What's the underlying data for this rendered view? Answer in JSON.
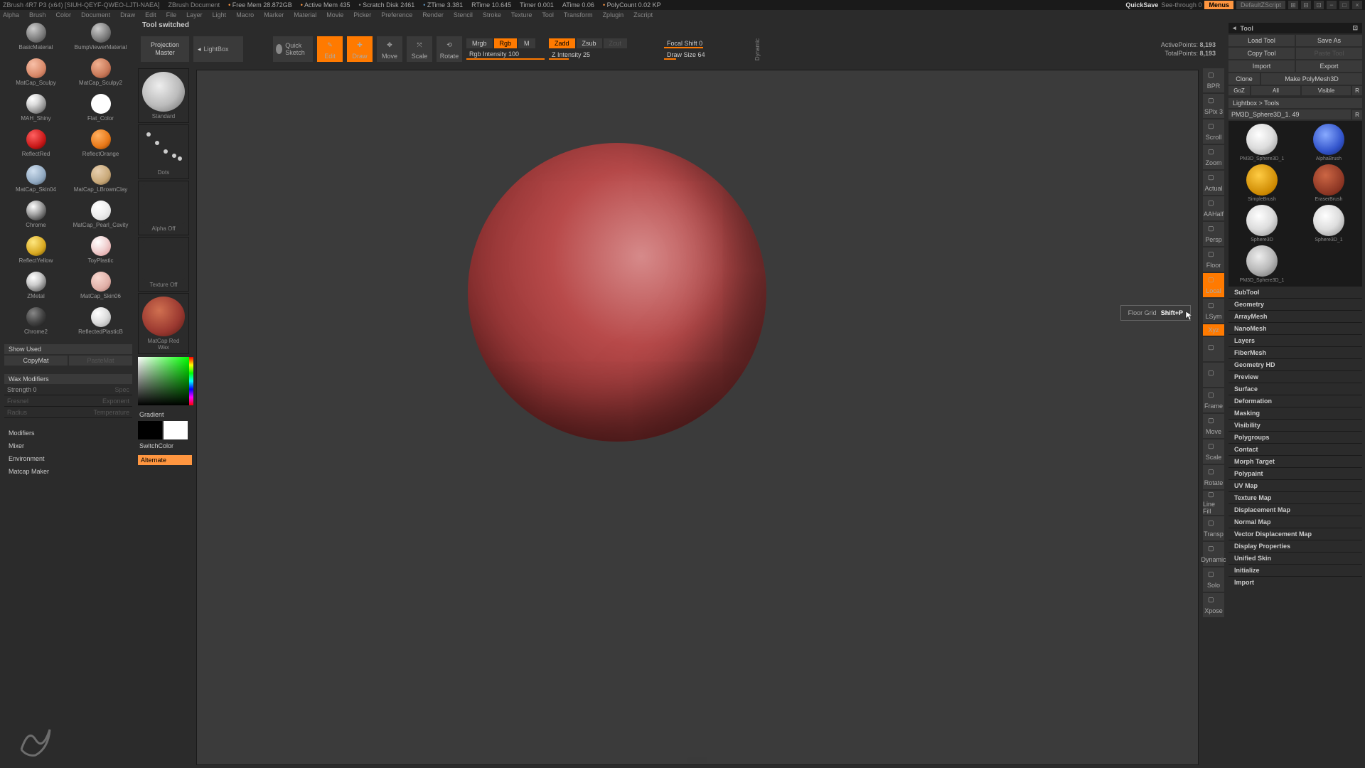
{
  "titlebar": {
    "app": "ZBrush 4R7 P3  (x64) [SIUH-QEYF-QWEO-LJTI-NAEA]",
    "doc": "ZBrush Document",
    "freemem_lbl": "Free Mem",
    "freemem": "28.872GB",
    "activemem_lbl": "Active Mem",
    "activemem": "435",
    "scratch_lbl": "Scratch Disk",
    "scratch": "2461",
    "ztime_lbl": "ZTime",
    "ztime": "3.381",
    "rtime_lbl": "RTime",
    "rtime": "10.645",
    "timer_lbl": "Timer",
    "timer": "0.001",
    "atime_lbl": "ATime",
    "atime": "0.06",
    "poly_lbl": "PolyCount",
    "poly": "0.02 KP",
    "quicksave": "QuickSave",
    "seethrough": "See-through  0",
    "menus": "Menus",
    "layout": "DefaultZScript"
  },
  "menu": [
    "Alpha",
    "Brush",
    "Color",
    "Document",
    "Draw",
    "Edit",
    "File",
    "Layer",
    "Light",
    "Macro",
    "Marker",
    "Material",
    "Movie",
    "Picker",
    "Preference",
    "Render",
    "Stencil",
    "Stroke",
    "Texture",
    "Tool",
    "Transform",
    "Zplugin",
    "Zscript"
  ],
  "status": "Tool switched",
  "toolbar": {
    "projection": "Projection Master",
    "lightbox": "LightBox",
    "quicksketch": "Quick Sketch",
    "edit": "Edit",
    "draw": "Draw",
    "move": "Move",
    "scale": "Scale",
    "rotate": "Rotate",
    "mrgb": "Mrgb",
    "rgb": "Rgb",
    "m": "M",
    "rgbint": "Rgb Intensity 100",
    "zadd": "Zadd",
    "zsub": "Zsub",
    "zcut": "Zcut",
    "zint": "Z Intensity 25",
    "focal": "Focal Shift 0",
    "drawsize": "Draw Size 64",
    "dynamic": "Dynamic",
    "activepts_lbl": "ActivePoints:",
    "activepts": "8,193",
    "totalpts_lbl": "TotalPoints:",
    "totalpts": "8,193"
  },
  "materials": [
    {
      "name": "BasicMaterial",
      "bg": "radial-gradient(circle at 35% 30%,#ccc,#777 60%,#333)"
    },
    {
      "name": "BumpViewerMaterial",
      "bg": "radial-gradient(circle at 35% 30%,#ccc,#777 60%,#333)"
    },
    {
      "name": "MatCap_Sculpy",
      "bg": "radial-gradient(circle at 35% 30%,#f8c0a8,#d88868 60%,#8a4a38)"
    },
    {
      "name": "MatCap_Sculpy2",
      "bg": "radial-gradient(circle at 35% 30%,#f0b090,#c87858 60%,#7a3a28)"
    },
    {
      "name": "MAH_Shiny",
      "bg": "radial-gradient(circle at 30% 25%,#fff,#ddd 30%,#888 70%,#222)"
    },
    {
      "name": "Flat_Color",
      "bg": "#fff"
    },
    {
      "name": "ReflectRed",
      "bg": "radial-gradient(circle at 35% 30%,#ff6060,#c81818 60%,#500)"
    },
    {
      "name": "ReflectOrange",
      "bg": "radial-gradient(circle at 35% 30%,#ffb060,#e87818 60%,#7a3800)"
    },
    {
      "name": "MatCap_Skin04",
      "bg": "radial-gradient(circle at 35% 30%,#d0e0f0,#90a8c0 60%,#405060)"
    },
    {
      "name": "MatCap_LBrownClay",
      "bg": "radial-gradient(circle at 35% 30%,#e8d0b0,#c8a878 60%,#705838)"
    },
    {
      "name": "Chrome",
      "bg": "radial-gradient(circle at 35% 30%,#fff,#aaa 40%,#444 80%,#000)"
    },
    {
      "name": "MatCap_Pearl_Cavity",
      "bg": "radial-gradient(circle at 35% 30%,#fff,#eee 50%,#ccc)"
    },
    {
      "name": "ReflectYellow",
      "bg": "radial-gradient(circle at 35% 30%,#ffe880,#d8a820 60%,#604800)"
    },
    {
      "name": "ToyPlastic",
      "bg": "radial-gradient(circle at 35% 30%,#fff,#f0d0d0 50%,#d89090)"
    },
    {
      "name": "ZMetal",
      "bg": "radial-gradient(circle at 35% 30%,#fff,#ccc 40%,#666 80%,#222)"
    },
    {
      "name": "MatCap_Skin06",
      "bg": "radial-gradient(circle at 35% 30%,#f8d8d0,#e0b0a8 60%,#a87068)"
    },
    {
      "name": "Chrome2",
      "bg": "radial-gradient(circle at 35% 30%,#888,#444 50%,#111)"
    },
    {
      "name": "ReflectedPlasticB",
      "bg": "radial-gradient(circle at 35% 30%,#fff,#ddd 50%,#999)"
    }
  ],
  "left": {
    "showused": "Show Used",
    "copy": "CopyMat",
    "paste": "PasteMat",
    "wax": "Wax Modifiers",
    "strength": "Strength 0",
    "spec": "Spec",
    "fresnel": "Fresnel",
    "exponent": "Exponent",
    "radius": "Radius",
    "temp": "Temperature",
    "acc": [
      "Modifiers",
      "Mixer",
      "Environment",
      "Matcap Maker"
    ]
  },
  "brushcol": {
    "standard": "Standard",
    "dots": "Dots",
    "alpha": "Alpha  Off",
    "texture": "Texture  Off",
    "matcap": "MatCap Red Wax",
    "gradient": "Gradient",
    "switch": "SwitchColor",
    "alternate": "Alternate"
  },
  "tooltip": {
    "label": "Floor Grid",
    "key": "Shift+P"
  },
  "rtools": [
    "BPR",
    "SPix 3",
    "Scroll",
    "Zoom",
    "Actual",
    "AAHalf",
    "Persp",
    "Floor",
    "Local",
    "LSym",
    "Xyz",
    "",
    "",
    "Frame",
    "Move",
    "Scale",
    "Rotate",
    "Line Fill",
    "Transp",
    "Dynamic",
    "Solo",
    "Xpose"
  ],
  "rpanel": {
    "title": "Tool",
    "load": "Load Tool",
    "saveas": "Save As",
    "copy": "Copy Tool",
    "paste": "Paste Tool",
    "import": "Import",
    "export": "Export",
    "clone": "Clone",
    "make": "Make PolyMesh3D",
    "goz": "GoZ",
    "all": "All",
    "visible": "Visible",
    "r": "R",
    "lbtools": "Lightbox > Tools",
    "toolname": "PM3D_Sphere3D_1. 49",
    "thumbs": [
      {
        "name": "PM3D_Sphere3D_1",
        "bg": "radial-gradient(circle at 40% 35%,#fff,#ddd 50%,#888)"
      },
      {
        "name": "AlphaBrush",
        "bg": "radial-gradient(circle at 40% 35%,#88aaff,#3355cc 60%,#112266)"
      },
      {
        "name": "SimpleBrush",
        "bg": "radial-gradient(circle at 40% 35%,#ffcc44,#cc8800 70%,#664400)",
        "foil": true
      },
      {
        "name": "EraserBrush",
        "bg": "radial-gradient(circle at 40% 35%,#cc6644,#883322 70%,#441100)"
      },
      {
        "name": "Sphere3D",
        "bg": "radial-gradient(circle at 40% 35%,#fff,#ddd 50%,#888)"
      },
      {
        "name": "Sphere3D_1",
        "bg": "radial-gradient(circle at 40% 35%,#fff,#ddd 50%,#888)"
      },
      {
        "name": "PM3D_Sphere3D_1",
        "bg": "radial-gradient(circle at 40% 35%,#eee,#bbb 50%,#666)"
      }
    ],
    "acc": [
      "SubTool",
      "Geometry",
      "ArrayMesh",
      "NanoMesh",
      "Layers",
      "FiberMesh",
      "Geometry HD",
      "Preview",
      "Surface",
      "Deformation",
      "Masking",
      "Visibility",
      "Polygroups",
      "Contact",
      "Morph Target",
      "Polypaint",
      "UV Map",
      "Texture Map",
      "Displacement Map",
      "Normal Map",
      "Vector Displacement Map",
      "Display Properties",
      "Unified Skin",
      "Initialize",
      "Import"
    ]
  }
}
